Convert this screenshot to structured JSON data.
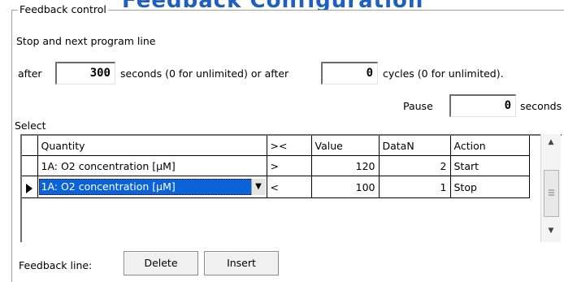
{
  "header": {
    "title": "Feedback Configuration"
  },
  "group": {
    "title": "Feedback control",
    "stop_label": "Stop and next program line"
  },
  "after": {
    "label": "after",
    "seconds_value": "300",
    "seconds_text": "seconds (0 for unlimited) or after",
    "cycles_value": "0",
    "cycles_text": "cycles (0 for unlimited)."
  },
  "pause": {
    "label": "Pause",
    "value": "0",
    "unit": "seconds"
  },
  "select_label": "Select",
  "table": {
    "headers": [
      "Quantity",
      "><",
      "Value",
      "DataN",
      "Action"
    ],
    "rows": [
      {
        "quantity": "1A: O2 concentration [µM]",
        "op": ">",
        "value": "120",
        "datan": "2",
        "action": "Start"
      },
      {
        "quantity": "1A: O2 concentration [µM]",
        "op": "<",
        "value": "100",
        "datan": "1",
        "action": "Stop"
      }
    ]
  },
  "footer": {
    "label": "Feedback line:",
    "delete": "Delete",
    "insert": "Insert"
  },
  "icons": {
    "row_pointer": "triangle-right-icon",
    "dropdown": "chevron-down-icon",
    "scroll_up": "arrow-up-icon",
    "scroll_down": "arrow-down-icon",
    "scroll_grip": "grip-icon"
  },
  "colors": {
    "selection": "#0a64d8",
    "title": "#1f5fbf"
  }
}
